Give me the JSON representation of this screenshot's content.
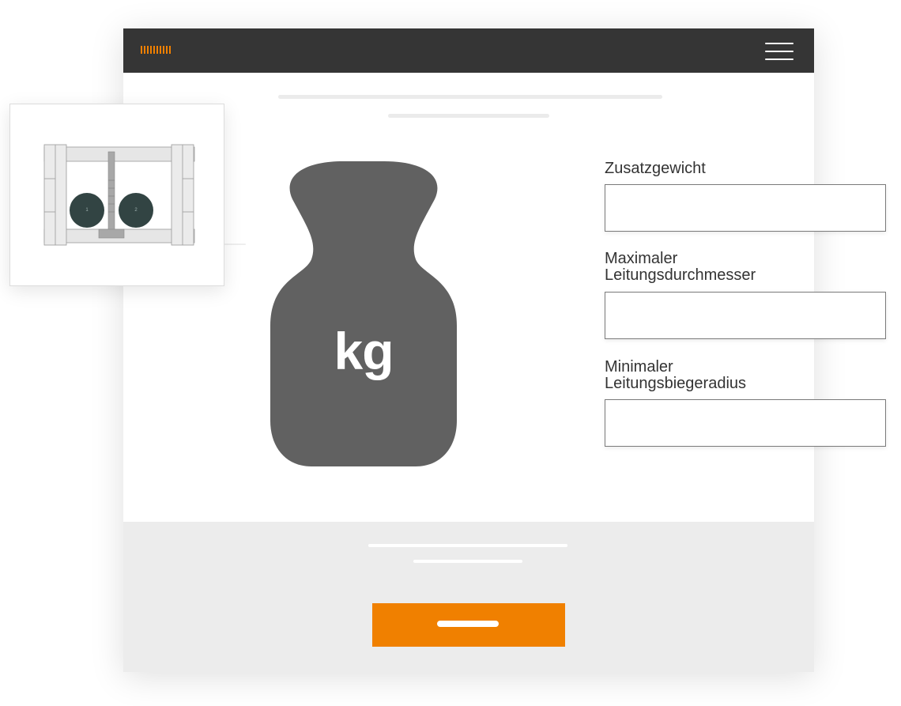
{
  "app": {
    "logo_icon": "brand-stripes-logo",
    "menu_icon": "hamburger-menu-icon"
  },
  "weight_icon": {
    "label": "kg"
  },
  "form": {
    "fields": [
      {
        "id": "zusatzgewicht",
        "label_lines": [
          "Zusatzgewicht"
        ],
        "value": ""
      },
      {
        "id": "max-leitungsdurchmesser",
        "label_lines": [
          "Maximaler",
          "Leitungsdurchmesser"
        ],
        "value": ""
      },
      {
        "id": "min-leitungsbiegeradius",
        "label_lines": [
          "Minimaler",
          "Leitungsbiegeradius"
        ],
        "value": ""
      }
    ]
  },
  "preview_card": {
    "wheels": [
      "1",
      "2"
    ]
  },
  "colors": {
    "topbar": "#353535",
    "accent": "#f08000",
    "weight": "#616161",
    "footer_bg": "#ececec",
    "wheel": "#324443"
  }
}
